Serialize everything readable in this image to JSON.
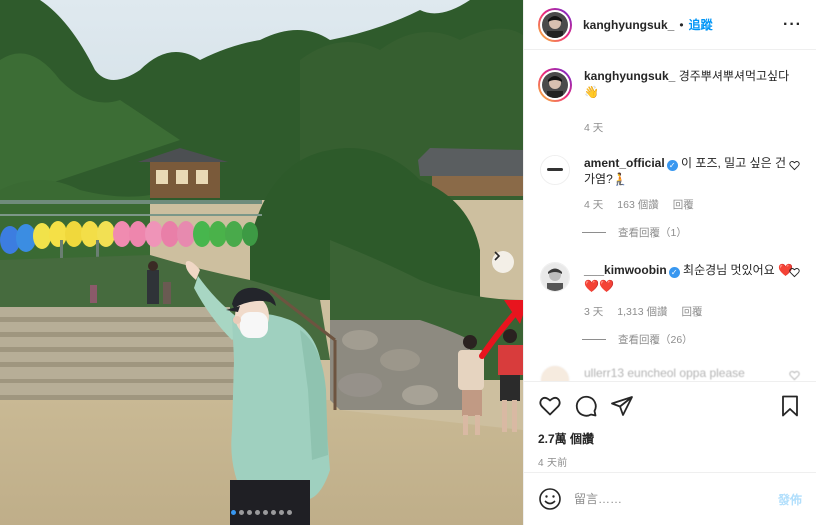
{
  "post": {
    "username": "kanghyungsuk_",
    "follow_label": "追蹤",
    "separator": "•",
    "more_label": "···",
    "caption_text": "경주뿌셔뿌셔먹고싶다 👋",
    "caption_time": "4 天",
    "likes": "2.7萬 個讚",
    "posted": "4 天前",
    "photo_slides": 8,
    "photo_active_slide": 1
  },
  "comments": [
    {
      "username": "ament_official",
      "verified": true,
      "text": "이 포즈, 밀고 싶은 건가염?🧎",
      "time": "4 天",
      "likes": "163 個讚",
      "reply_label": "回覆",
      "view_replies": "查看回覆（1）"
    },
    {
      "username": "___kimwoobin",
      "verified": true,
      "text": "최순경님 멋있어요 ❤️❤️❤️",
      "time": "3 天",
      "likes": "1,313 個讚",
      "reply_label": "回覆",
      "view_replies": "查看回覆（26）"
    },
    {
      "username": "ullerr13",
      "verified": false,
      "text": "euncheol oppa please",
      "time": "",
      "likes": "",
      "reply_label": "",
      "view_replies": ""
    }
  ],
  "composer": {
    "placeholder": "留言……",
    "post_label": "發佈"
  },
  "colors": {
    "link_blue": "#0095f6",
    "post_disabled": "#b2dffc",
    "muted_text": "#8e8e8e",
    "border": "#efefef",
    "annotation_arrow": "#e8141e"
  },
  "icons": [
    "heart-icon",
    "comment-icon",
    "share-icon",
    "bookmark-icon",
    "emoji-icon",
    "verified-icon",
    "chevron-right-icon",
    "more-options-icon"
  ]
}
